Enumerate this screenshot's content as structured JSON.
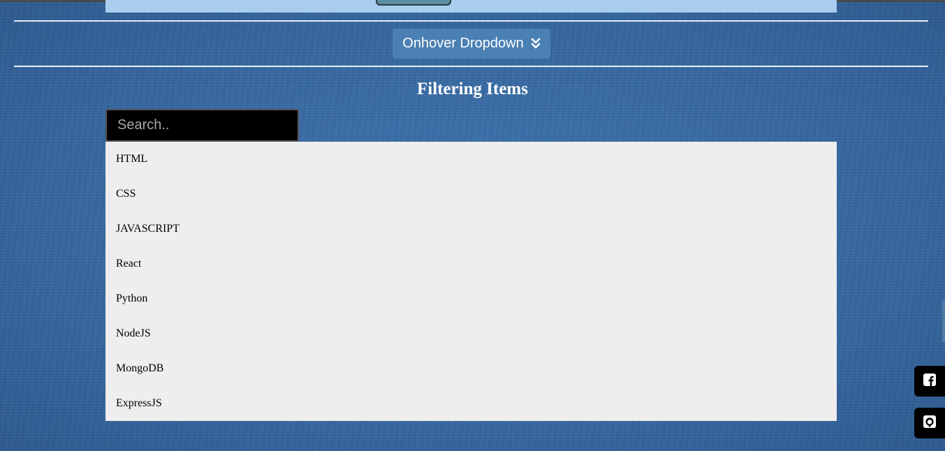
{
  "dropdown": {
    "label": "Onhover Dropdown",
    "icon": "double-chevron-down-icon"
  },
  "filter": {
    "title": "Filtering Items",
    "search_placeholder": "Search..",
    "items": [
      "HTML",
      "CSS",
      "JAVASCRIPT",
      "React",
      "Python",
      "NodeJS",
      "MongoDB",
      "ExpressJS"
    ]
  },
  "social": {
    "facebook_icon": "facebook-icon",
    "github_icon": "github-icon"
  },
  "colors": {
    "background": "#3a6ea7",
    "dropdown_button": "#4a80b4",
    "list_background": "#eeeeee",
    "search_background": "#000000",
    "top_panel": "#a9cdee"
  }
}
